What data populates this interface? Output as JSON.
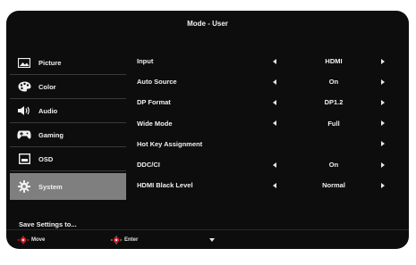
{
  "window": {
    "title": "Mode - User"
  },
  "sidebar": {
    "items": [
      {
        "label": "Picture",
        "icon": "picture-icon",
        "selected": false
      },
      {
        "label": "Color",
        "icon": "palette-icon",
        "selected": false
      },
      {
        "label": "Audio",
        "icon": "speaker-icon",
        "selected": false
      },
      {
        "label": "Gaming",
        "icon": "gamepad-icon",
        "selected": false
      },
      {
        "label": "OSD",
        "icon": "osd-icon",
        "selected": false
      },
      {
        "label": "System",
        "icon": "gear-icon",
        "selected": true
      }
    ],
    "save_label": "Save Settings to..."
  },
  "settings": [
    {
      "label": "Input",
      "value": "HDMI",
      "left_arrow": true,
      "right_arrow": true
    },
    {
      "label": "Auto Source",
      "value": "On",
      "left_arrow": true,
      "right_arrow": true
    },
    {
      "label": "DP Format",
      "value": "DP1.2",
      "left_arrow": true,
      "right_arrow": true
    },
    {
      "label": "Wide Mode",
      "value": "Full",
      "left_arrow": true,
      "right_arrow": true
    },
    {
      "label": "Hot Key Assignment",
      "value": "",
      "left_arrow": false,
      "right_arrow": true
    },
    {
      "label": "DDC/CI",
      "value": "On",
      "left_arrow": true,
      "right_arrow": true
    },
    {
      "label": "HDMI Black Level",
      "value": "Normal",
      "left_arrow": true,
      "right_arrow": true
    }
  ],
  "footer": {
    "move_label": "Move",
    "enter_label": "Enter"
  },
  "colors": {
    "background": "#0d0d0d",
    "selected": "#7f7f7f",
    "accent_red": "#d81f26"
  }
}
